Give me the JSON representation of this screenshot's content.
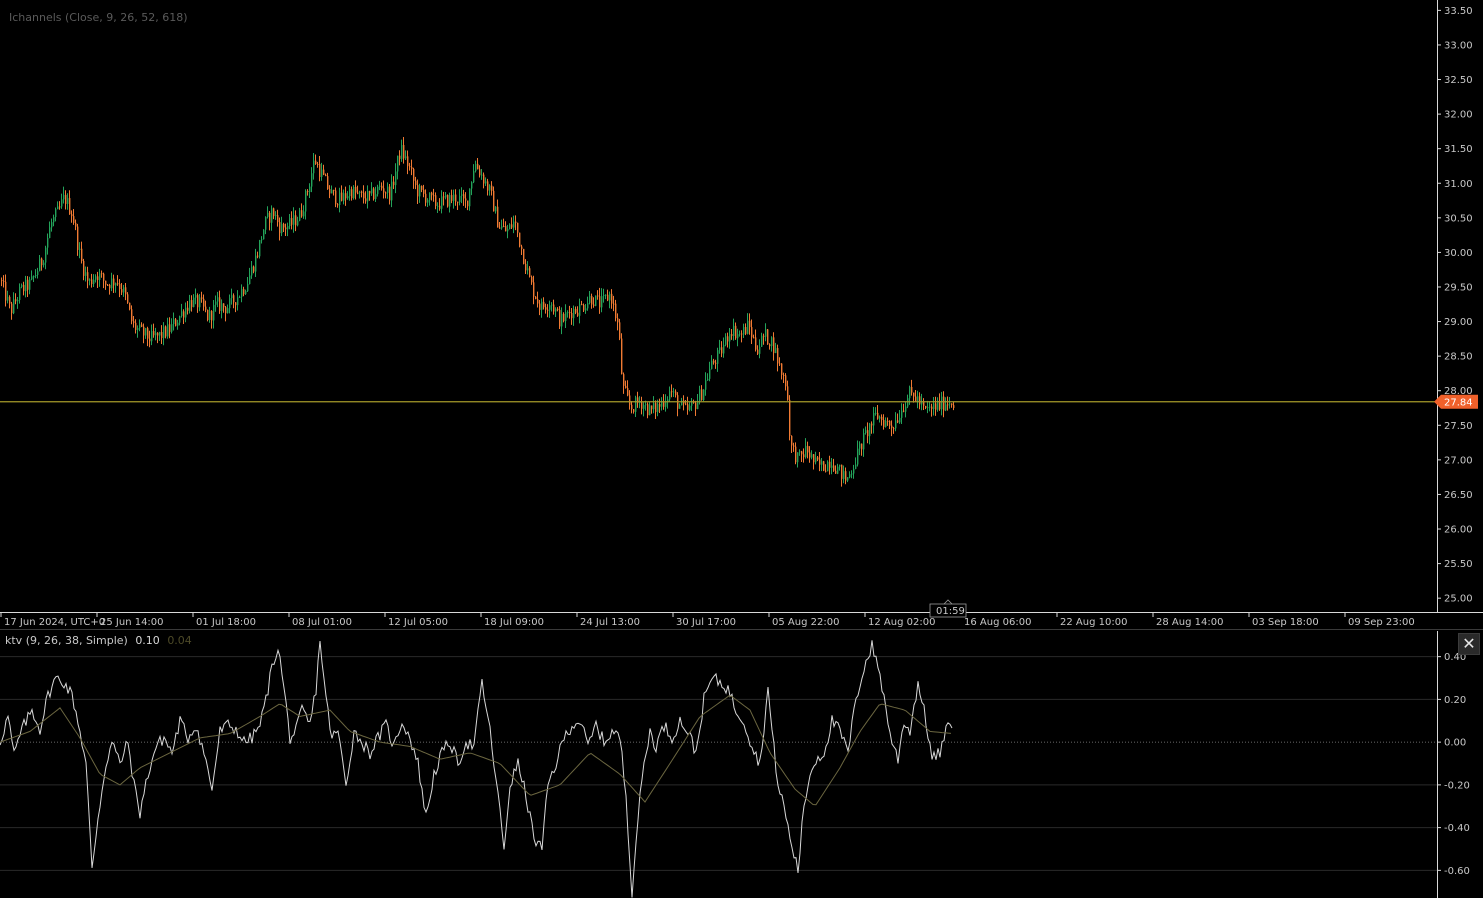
{
  "top_indicator": {
    "label": "Ichannels (Close, 9, 26, 52, 618)"
  },
  "bottom_indicator": {
    "label": "ktv (9, 26, 38, Simple)",
    "value_main": "0.10",
    "value_signal": "0.04"
  },
  "time_badge": "01:59",
  "price_badge": "27.84",
  "close_button": "✕",
  "colors": {
    "background": "#000000",
    "axis": "#d9d9d9",
    "up_candle": "#23a35a",
    "down_candle": "#f07a33",
    "price_line": "#a59a2a",
    "price_badge_bg": "#f0602a",
    "ktv_main": "#d8d8d8",
    "ktv_signal": "#6b6640",
    "grid": "#2a2a2a"
  },
  "chart_data": [
    {
      "type": "candlestick",
      "y_ticks": [
        "33.50",
        "33.00",
        "32.50",
        "32.00",
        "31.50",
        "31.00",
        "30.50",
        "30.00",
        "29.50",
        "29.00",
        "28.50",
        "28.00",
        "27.50",
        "27.00",
        "26.50",
        "26.00",
        "25.50",
        "25.00"
      ],
      "x_ticks": [
        "17 Jun 2024, UTC+0",
        "25 Jun 14:00",
        "01 Jul 18:00",
        "08 Jul 01:00",
        "12 Jul 05:00",
        "18 Jul 09:00",
        "24 Jul 13:00",
        "30 Jul 17:00",
        "05 Aug 22:00",
        "12 Aug 02:00",
        "16 Aug 06:00",
        "22 Aug 10:00",
        "28 Aug 14:00",
        "03 Sep 18:00",
        "09 Sep 23:00"
      ],
      "ylim": [
        24.8,
        33.65
      ],
      "current_price": 27.84,
      "path": [
        [
          0,
          29.6
        ],
        [
          10,
          29.15
        ],
        [
          20,
          29.45
        ],
        [
          30,
          29.55
        ],
        [
          42,
          29.9
        ],
        [
          50,
          30.4
        ],
        [
          58,
          30.6
        ],
        [
          64,
          30.8
        ],
        [
          72,
          30.55
        ],
        [
          80,
          29.9
        ],
        [
          88,
          29.55
        ],
        [
          96,
          29.7
        ],
        [
          106,
          29.55
        ],
        [
          116,
          29.6
        ],
        [
          124,
          29.4
        ],
        [
          132,
          28.95
        ],
        [
          140,
          28.85
        ],
        [
          150,
          28.75
        ],
        [
          160,
          28.8
        ],
        [
          170,
          28.9
        ],
        [
          180,
          29.1
        ],
        [
          190,
          29.3
        ],
        [
          200,
          29.25
        ],
        [
          208,
          29.05
        ],
        [
          216,
          29.25
        ],
        [
          226,
          29.2
        ],
        [
          236,
          29.35
        ],
        [
          246,
          29.55
        ],
        [
          256,
          29.95
        ],
        [
          264,
          30.4
        ],
        [
          272,
          30.6
        ],
        [
          280,
          30.35
        ],
        [
          290,
          30.4
        ],
        [
          300,
          30.55
        ],
        [
          308,
          30.95
        ],
        [
          314,
          31.35
        ],
        [
          322,
          31.1
        ],
        [
          330,
          30.85
        ],
        [
          340,
          30.75
        ],
        [
          350,
          30.9
        ],
        [
          360,
          30.8
        ],
        [
          370,
          30.8
        ],
        [
          380,
          30.95
        ],
        [
          390,
          30.85
        ],
        [
          400,
          31.5
        ],
        [
          408,
          31.25
        ],
        [
          416,
          30.9
        ],
        [
          426,
          30.8
        ],
        [
          436,
          30.7
        ],
        [
          446,
          30.75
        ],
        [
          456,
          30.8
        ],
        [
          466,
          30.7
        ],
        [
          474,
          31.3
        ],
        [
          482,
          31.1
        ],
        [
          490,
          30.85
        ],
        [
          498,
          30.4
        ],
        [
          506,
          30.3
        ],
        [
          514,
          30.45
        ],
        [
          522,
          30.0
        ],
        [
          530,
          29.55
        ],
        [
          540,
          29.2
        ],
        [
          550,
          29.3
        ],
        [
          560,
          29.0
        ],
        [
          570,
          29.15
        ],
        [
          580,
          29.2
        ],
        [
          590,
          29.35
        ],
        [
          600,
          29.25
        ],
        [
          610,
          29.4
        ],
        [
          618,
          28.9
        ],
        [
          622,
          28.05
        ],
        [
          630,
          27.75
        ],
        [
          640,
          27.85
        ],
        [
          650,
          27.7
        ],
        [
          660,
          27.8
        ],
        [
          670,
          28.0
        ],
        [
          678,
          27.8
        ],
        [
          686,
          27.7
        ],
        [
          694,
          27.8
        ],
        [
          702,
          28.0
        ],
        [
          710,
          28.35
        ],
        [
          720,
          28.55
        ],
        [
          730,
          28.9
        ],
        [
          740,
          28.8
        ],
        [
          748,
          28.95
        ],
        [
          756,
          28.6
        ],
        [
          764,
          28.8
        ],
        [
          772,
          28.7
        ],
        [
          780,
          28.3
        ],
        [
          786,
          28.1
        ],
        [
          790,
          27.2
        ],
        [
          798,
          27.0
        ],
        [
          806,
          27.15
        ],
        [
          814,
          26.95
        ],
        [
          822,
          26.9
        ],
        [
          830,
          27.0
        ],
        [
          838,
          26.85
        ],
        [
          846,
          26.7
        ],
        [
          852,
          26.9
        ],
        [
          860,
          27.2
        ],
        [
          868,
          27.45
        ],
        [
          876,
          27.65
        ],
        [
          884,
          27.55
        ],
        [
          892,
          27.5
        ],
        [
          900,
          27.7
        ],
        [
          908,
          27.95
        ],
        [
          916,
          27.9
        ],
        [
          924,
          27.7
        ],
        [
          932,
          27.75
        ],
        [
          940,
          27.8
        ],
        [
          948,
          27.85
        ],
        [
          953,
          27.84
        ]
      ]
    },
    {
      "type": "line",
      "series": [
        {
          "values": [
            [
              0,
              0.0
            ],
            [
              8,
              0.12
            ],
            [
              14,
              -0.06
            ],
            [
              22,
              0.06
            ],
            [
              32,
              0.15
            ],
            [
              40,
              0.06
            ],
            [
              48,
              0.22
            ],
            [
              56,
              0.3
            ],
            [
              64,
              0.28
            ],
            [
              72,
              0.22
            ],
            [
              78,
              0.1
            ],
            [
              86,
              -0.1
            ],
            [
              92,
              -0.6
            ],
            [
              98,
              -0.35
            ],
            [
              106,
              -0.1
            ],
            [
              112,
              0.0
            ],
            [
              120,
              -0.1
            ],
            [
              128,
              0.0
            ],
            [
              134,
              -0.2
            ],
            [
              140,
              -0.33
            ],
            [
              148,
              -0.15
            ],
            [
              156,
              -0.02
            ],
            [
              164,
              0.02
            ],
            [
              172,
              -0.05
            ],
            [
              180,
              0.1
            ],
            [
              188,
              0.02
            ],
            [
              196,
              0.08
            ],
            [
              204,
              -0.05
            ],
            [
              212,
              -0.22
            ],
            [
              220,
              0.05
            ],
            [
              228,
              0.08
            ],
            [
              236,
              0.06
            ],
            [
              244,
              0.0
            ],
            [
              252,
              0.02
            ],
            [
              260,
              0.08
            ],
            [
              266,
              0.2
            ],
            [
              272,
              0.35
            ],
            [
              278,
              0.45
            ],
            [
              284,
              0.25
            ],
            [
              290,
              0.02
            ],
            [
              296,
              0.05
            ],
            [
              302,
              0.15
            ],
            [
              310,
              0.08
            ],
            [
              316,
              0.25
            ],
            [
              320,
              0.48
            ],
            [
              326,
              0.2
            ],
            [
              332,
              0.02
            ],
            [
              338,
              0.05
            ],
            [
              346,
              -0.2
            ],
            [
              354,
              0.05
            ],
            [
              362,
              0.0
            ],
            [
              370,
              -0.05
            ],
            [
              378,
              0.02
            ],
            [
              386,
              0.08
            ],
            [
              394,
              -0.02
            ],
            [
              402,
              0.1
            ],
            [
              410,
              0.02
            ],
            [
              418,
              -0.1
            ],
            [
              426,
              -0.35
            ],
            [
              434,
              -0.15
            ],
            [
              442,
              -0.05
            ],
            [
              450,
              0.0
            ],
            [
              458,
              -0.1
            ],
            [
              466,
              0.0
            ],
            [
              474,
              -0.02
            ],
            [
              482,
              0.28
            ],
            [
              490,
              0.05
            ],
            [
              498,
              -0.25
            ],
            [
              504,
              -0.5
            ],
            [
              510,
              -0.2
            ],
            [
              518,
              -0.1
            ],
            [
              526,
              -0.25
            ],
            [
              534,
              -0.45
            ],
            [
              542,
              -0.5
            ],
            [
              548,
              -0.2
            ],
            [
              556,
              -0.1
            ],
            [
              564,
              0.02
            ],
            [
              572,
              0.08
            ],
            [
              580,
              0.1
            ],
            [
              588,
              -0.02
            ],
            [
              596,
              0.08
            ],
            [
              604,
              0.0
            ],
            [
              612,
              0.05
            ],
            [
              620,
              0.02
            ],
            [
              626,
              -0.25
            ],
            [
              632,
              -0.7
            ],
            [
              638,
              -0.35
            ],
            [
              644,
              -0.1
            ],
            [
              650,
              0.05
            ],
            [
              656,
              -0.02
            ],
            [
              664,
              0.08
            ],
            [
              672,
              0.02
            ],
            [
              680,
              0.1
            ],
            [
              688,
              0.05
            ],
            [
              696,
              -0.05
            ],
            [
              704,
              0.2
            ],
            [
              712,
              0.3
            ],
            [
              720,
              0.28
            ],
            [
              728,
              0.25
            ],
            [
              736,
              0.15
            ],
            [
              744,
              0.1
            ],
            [
              752,
              -0.02
            ],
            [
              760,
              -0.1
            ],
            [
              768,
              0.25
            ],
            [
              772,
              0.05
            ],
            [
              778,
              -0.2
            ],
            [
              784,
              -0.3
            ],
            [
              790,
              -0.45
            ],
            [
              798,
              -0.6
            ],
            [
              804,
              -0.3
            ],
            [
              810,
              -0.15
            ],
            [
              816,
              -0.08
            ],
            [
              824,
              -0.05
            ],
            [
              832,
              0.1
            ],
            [
              840,
              0.05
            ],
            [
              848,
              -0.05
            ],
            [
              856,
              0.2
            ],
            [
              864,
              0.35
            ],
            [
              872,
              0.45
            ],
            [
              880,
              0.32
            ],
            [
              886,
              0.15
            ],
            [
              892,
              0.0
            ],
            [
              898,
              -0.08
            ],
            [
              904,
              0.1
            ],
            [
              910,
              0.05
            ],
            [
              918,
              0.28
            ],
            [
              926,
              0.1
            ],
            [
              932,
              -0.08
            ],
            [
              940,
              -0.05
            ],
            [
              946,
              0.05
            ],
            [
              953,
              0.1
            ]
          ]
        },
        {
          "values": [
            [
              0,
              0.0
            ],
            [
              30,
              0.05
            ],
            [
              60,
              0.16
            ],
            [
              80,
              0.02
            ],
            [
              100,
              -0.15
            ],
            [
              120,
              -0.2
            ],
            [
              140,
              -0.12
            ],
            [
              170,
              -0.05
            ],
            [
              200,
              0.02
            ],
            [
              230,
              0.04
            ],
            [
              260,
              0.12
            ],
            [
              280,
              0.18
            ],
            [
              300,
              0.12
            ],
            [
              330,
              0.15
            ],
            [
              350,
              0.05
            ],
            [
              380,
              0.0
            ],
            [
              410,
              -0.02
            ],
            [
              440,
              -0.08
            ],
            [
              470,
              -0.05
            ],
            [
              500,
              -0.1
            ],
            [
              530,
              -0.25
            ],
            [
              560,
              -0.2
            ],
            [
              590,
              -0.05
            ],
            [
              620,
              -0.15
            ],
            [
              645,
              -0.28
            ],
            [
              670,
              -0.1
            ],
            [
              700,
              0.12
            ],
            [
              730,
              0.22
            ],
            [
              750,
              0.15
            ],
            [
              770,
              -0.05
            ],
            [
              795,
              -0.22
            ],
            [
              815,
              -0.3
            ],
            [
              840,
              -0.12
            ],
            [
              860,
              0.05
            ],
            [
              880,
              0.18
            ],
            [
              905,
              0.15
            ],
            [
              930,
              0.05
            ],
            [
              953,
              0.04
            ]
          ]
        }
      ],
      "y_ticks": [
        "0.40",
        "0.20",
        "0.00",
        "-0.20",
        "-0.40",
        "-0.60"
      ],
      "ylim": [
        -0.72,
        0.52
      ]
    }
  ]
}
